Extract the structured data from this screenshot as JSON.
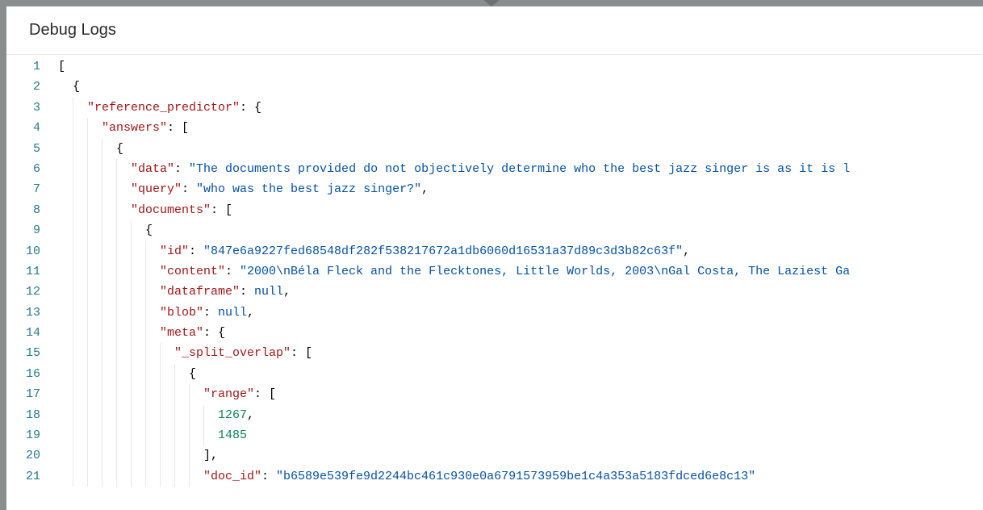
{
  "header": {
    "title": "Debug Logs"
  },
  "code": {
    "lines": [
      {
        "num": 1,
        "indent": 0,
        "tokens": [
          {
            "t": "[",
            "c": "p"
          }
        ]
      },
      {
        "num": 2,
        "indent": 1,
        "tokens": [
          {
            "t": "{",
            "c": "p"
          }
        ]
      },
      {
        "num": 3,
        "indent": 2,
        "tokens": [
          {
            "t": "\"reference_predictor\"",
            "c": "k"
          },
          {
            "t": ": {",
            "c": "p"
          }
        ]
      },
      {
        "num": 4,
        "indent": 3,
        "tokens": [
          {
            "t": "\"answers\"",
            "c": "k"
          },
          {
            "t": ": [",
            "c": "p"
          }
        ]
      },
      {
        "num": 5,
        "indent": 4,
        "tokens": [
          {
            "t": "{",
            "c": "p"
          }
        ]
      },
      {
        "num": 6,
        "indent": 5,
        "tokens": [
          {
            "t": "\"data\"",
            "c": "k"
          },
          {
            "t": ": ",
            "c": "p"
          },
          {
            "t": "\"The documents provided do not objectively determine who the best jazz singer is as it is l",
            "c": "s"
          }
        ]
      },
      {
        "num": 7,
        "indent": 5,
        "tokens": [
          {
            "t": "\"query\"",
            "c": "k"
          },
          {
            "t": ": ",
            "c": "p"
          },
          {
            "t": "\"who was the best jazz singer?\"",
            "c": "s"
          },
          {
            "t": ",",
            "c": "p"
          }
        ]
      },
      {
        "num": 8,
        "indent": 5,
        "tokens": [
          {
            "t": "\"documents\"",
            "c": "k"
          },
          {
            "t": ": [",
            "c": "p"
          }
        ]
      },
      {
        "num": 9,
        "indent": 6,
        "tokens": [
          {
            "t": "{",
            "c": "p"
          }
        ]
      },
      {
        "num": 10,
        "indent": 7,
        "tokens": [
          {
            "t": "\"id\"",
            "c": "k"
          },
          {
            "t": ": ",
            "c": "p"
          },
          {
            "t": "\"847e6a9227fed68548df282f538217672a1db6060d16531a37d89c3d3b82c63f\"",
            "c": "s"
          },
          {
            "t": ",",
            "c": "p"
          }
        ]
      },
      {
        "num": 11,
        "indent": 7,
        "tokens": [
          {
            "t": "\"content\"",
            "c": "k"
          },
          {
            "t": ": ",
            "c": "p"
          },
          {
            "t": "\"2000\\nBéla Fleck and the Flecktones, Little Worlds, 2003\\nGal Costa, The Laziest Ga",
            "c": "s"
          }
        ]
      },
      {
        "num": 12,
        "indent": 7,
        "tokens": [
          {
            "t": "\"dataframe\"",
            "c": "k"
          },
          {
            "t": ": ",
            "c": "p"
          },
          {
            "t": "null",
            "c": "u"
          },
          {
            "t": ",",
            "c": "p"
          }
        ]
      },
      {
        "num": 13,
        "indent": 7,
        "tokens": [
          {
            "t": "\"blob\"",
            "c": "k"
          },
          {
            "t": ": ",
            "c": "p"
          },
          {
            "t": "null",
            "c": "u"
          },
          {
            "t": ",",
            "c": "p"
          }
        ]
      },
      {
        "num": 14,
        "indent": 7,
        "tokens": [
          {
            "t": "\"meta\"",
            "c": "k"
          },
          {
            "t": ": {",
            "c": "p"
          }
        ]
      },
      {
        "num": 15,
        "indent": 8,
        "tokens": [
          {
            "t": "\"_split_overlap\"",
            "c": "k"
          },
          {
            "t": ": [",
            "c": "p"
          }
        ]
      },
      {
        "num": 16,
        "indent": 9,
        "tokens": [
          {
            "t": "{",
            "c": "p"
          }
        ]
      },
      {
        "num": 17,
        "indent": 10,
        "tokens": [
          {
            "t": "\"range\"",
            "c": "k"
          },
          {
            "t": ": [",
            "c": "p"
          }
        ]
      },
      {
        "num": 18,
        "indent": 11,
        "tokens": [
          {
            "t": "1267",
            "c": "n"
          },
          {
            "t": ",",
            "c": "p"
          }
        ]
      },
      {
        "num": 19,
        "indent": 11,
        "tokens": [
          {
            "t": "1485",
            "c": "n"
          }
        ]
      },
      {
        "num": 20,
        "indent": 10,
        "tokens": [
          {
            "t": "],",
            "c": "p"
          }
        ]
      },
      {
        "num": 21,
        "indent": 10,
        "tokens": [
          {
            "t": "\"doc_id\"",
            "c": "k"
          },
          {
            "t": ": ",
            "c": "p"
          },
          {
            "t": "\"b6589e539fe9d2244bc461c930e0a6791573959be1c4a353a5183fdced6e8c13\"",
            "c": "s"
          }
        ]
      }
    ]
  }
}
